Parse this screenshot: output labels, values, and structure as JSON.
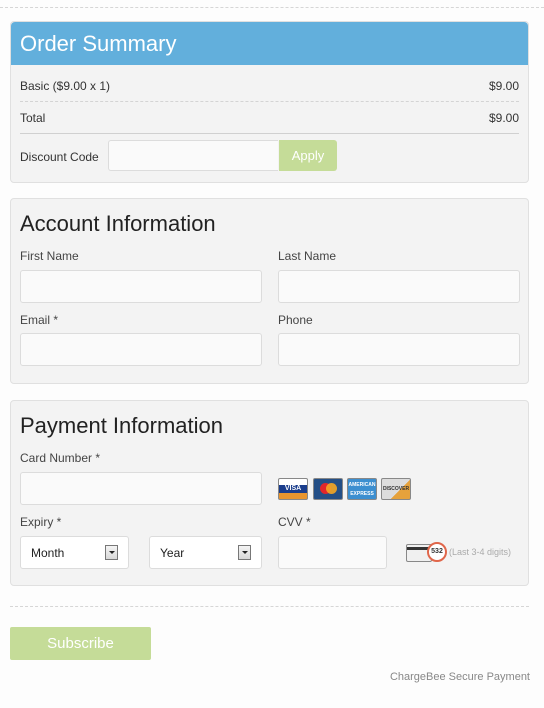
{
  "order_summary": {
    "title": "Order Summary",
    "line_item": {
      "label": "Basic ($9.00 x 1)",
      "amount": "$9.00"
    },
    "total": {
      "label": "Total",
      "amount": "$9.00"
    },
    "discount": {
      "label": "Discount Code",
      "value": "",
      "apply_label": "Apply"
    }
  },
  "account": {
    "title": "Account Information",
    "fields": {
      "first_name": {
        "label": "First Name",
        "value": ""
      },
      "last_name": {
        "label": "Last Name",
        "value": ""
      },
      "email": {
        "label": "Email *",
        "value": ""
      },
      "phone": {
        "label": "Phone",
        "value": ""
      }
    }
  },
  "payment": {
    "title": "Payment Information",
    "card_number": {
      "label": "Card Number *",
      "value": ""
    },
    "card_brands": [
      "VISA",
      "MasterCard",
      "American Express",
      "Discover"
    ],
    "card_brand_labels": {
      "visa": "VISA",
      "amex": "AMERICAN EXPRESS",
      "discover": "DISCOVER"
    },
    "expiry": {
      "label": "Expiry *",
      "month": "Month",
      "year": "Year"
    },
    "cvv": {
      "label": "CVV *",
      "value": "",
      "example": "532",
      "hint": "(Last 3-4 digits)"
    }
  },
  "actions": {
    "subscribe_label": "Subscribe"
  },
  "footer": {
    "text": "ChargeBee Secure Payment"
  },
  "colors": {
    "header_blue": "#62afdc",
    "button_green": "#c5dc98",
    "cvv_circle": "#e0664a"
  }
}
